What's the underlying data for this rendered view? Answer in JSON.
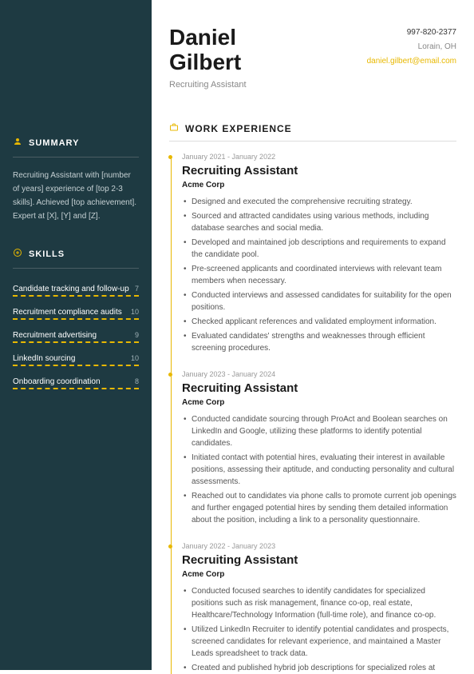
{
  "name_first": "Daniel",
  "name_last": "Gilbert",
  "job_title": "Recruiting Assistant",
  "contact": {
    "phone": "997-820-2377",
    "location": "Lorain, OH",
    "email": "daniel.gilbert@email.com"
  },
  "sidebar": {
    "summary_title": "SUMMARY",
    "summary_text": "Recruiting Assistant with [number of years] experience of [top 2-3 skills]. Achieved [top achievement]. Expert at [X], [Y] and [Z].",
    "skills_title": "SKILLS",
    "skills": [
      {
        "name": "Candidate tracking and follow-up",
        "rating": "7"
      },
      {
        "name": "Recruitment compliance audits",
        "rating": "10"
      },
      {
        "name": "Recruitment advertising",
        "rating": "9"
      },
      {
        "name": "LinkedIn sourcing",
        "rating": "10"
      },
      {
        "name": "Onboarding coordination",
        "rating": "8"
      }
    ]
  },
  "work": {
    "title": "WORK EXPERIENCE",
    "jobs": [
      {
        "dates": "January 2021 - January 2022",
        "role": "Recruiting Assistant",
        "company": "Acme Corp",
        "bullets": [
          "Designed and executed the comprehensive recruiting strategy.",
          "Sourced and attracted candidates using various methods, including database searches and social media.",
          "Developed and maintained job descriptions and requirements to expand the candidate pool.",
          "Pre-screened applicants and coordinated interviews with relevant team members when necessary.",
          "Conducted interviews and assessed candidates for suitability for the open positions.",
          "Checked applicant references and validated employment information.",
          "Evaluated candidates' strengths and weaknesses through efficient screening procedures."
        ]
      },
      {
        "dates": "January 2023 - January 2024",
        "role": "Recruiting Assistant",
        "company": "Acme Corp",
        "bullets": [
          "Conducted candidate sourcing through ProAct and Boolean searches on LinkedIn and Google, utilizing these platforms to identify potential candidates.",
          "Initiated contact with potential hires, evaluating their interest in available positions, assessing their aptitude, and conducting personality and cultural assessments.",
          "Reached out to candidates via phone calls to promote current job openings and further engaged potential hires by sending them detailed information about the position, including a link to a personality questionnaire."
        ]
      },
      {
        "dates": "January 2022 - January 2023",
        "role": "Recruiting Assistant",
        "company": "Acme Corp",
        "bullets": [
          "Conducted focused searches to identify candidates for specialized positions such as risk management, finance co-op, real estate, Healthcare/Technology Information (full-time role), and finance co-op.",
          "Utilized LinkedIn Recruiter to identify potential candidates and prospects, screened candidates for relevant experience, and maintained a Master Leads spreadsheet to track data.",
          "Created and published hybrid job descriptions for specialized roles at"
        ]
      }
    ]
  }
}
